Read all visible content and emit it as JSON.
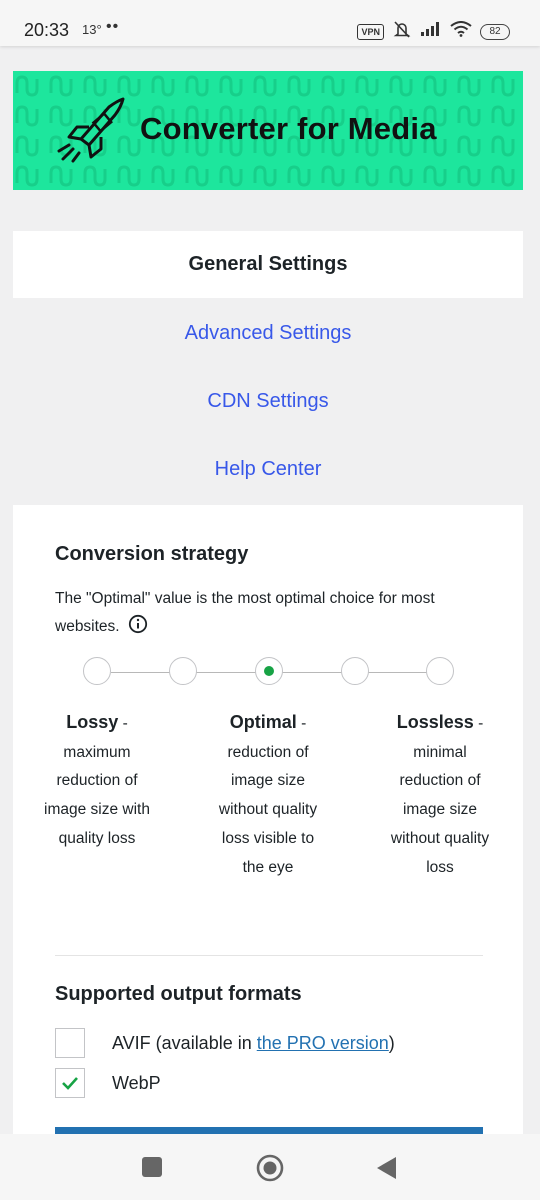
{
  "status_bar": {
    "time": "20:33",
    "temperature": "13°",
    "dots": "••",
    "vpn": "VPN",
    "battery": "82"
  },
  "banner": {
    "title": "Converter for Media",
    "background_color": "#1de69d",
    "logo_icon": "rocket-icon"
  },
  "nav": {
    "active": "General Settings",
    "links": [
      "Advanced Settings",
      "CDN Settings",
      "Help Center"
    ],
    "link_color": "#3858e9"
  },
  "conversion_strategy": {
    "heading": "Conversion strategy",
    "description": "The \"Optimal\" value is the most optimal choice for most websites.",
    "selected_index": 2,
    "options": [
      {
        "name": "Lossy",
        "sep": " -",
        "text": "maximum reduction of image size with quality loss"
      },
      {
        "name": "Optimal",
        "sep": " -",
        "text": "reduction of image size without quality loss visible to the eye"
      },
      {
        "name": "Lossless",
        "sep": " -",
        "text": "minimal reduction of image size without quality loss"
      }
    ],
    "selected_color": "#17a345"
  },
  "output_formats": {
    "heading": "Supported output formats",
    "avif": {
      "prefix": "AVIF (available in ",
      "link": "the PRO version",
      "suffix": ")",
      "checked": false
    },
    "webp": {
      "label": "WebP",
      "checked": true
    }
  },
  "accent_color": "#2271b1"
}
